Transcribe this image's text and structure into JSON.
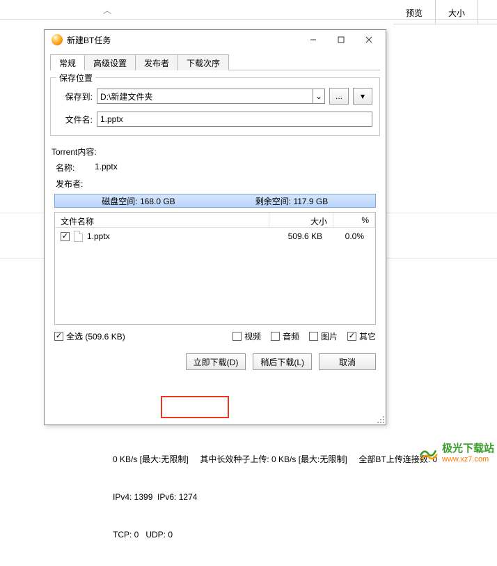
{
  "bg": {
    "col_preview": "预览",
    "col_size": "大小",
    "status_line1_a": "0 KB/s [最大:无限制]",
    "status_line1_b": "其中长效种子上传: 0 KB/s [最大:无限制]",
    "status_line1_c": "全部BT上传连接数: 0",
    "status_line2": "IPv4: 1399  IPv6: 1274",
    "status_line3": "TCP: 0   UDP: 0"
  },
  "dialog": {
    "title": "新建BT任务",
    "tabs": {
      "general": "常规",
      "advanced": "高级设置",
      "publisher": "发布者",
      "order": "下载次序"
    },
    "save_group": "保存位置",
    "save_to_label": "保存到:",
    "save_to_value": "D:\\新建文件夹",
    "browse_ellipsis": "...",
    "dropdown_caret": "▾",
    "filename_label": "文件名:",
    "filename_value": "1.pptx",
    "torrent_header": "Torrent内容:",
    "name_label": "名称:",
    "name_value": "1.pptx",
    "publisher_label": "发布者:",
    "publisher_value": "",
    "disk_total_label": "磁盘空间:",
    "disk_total_value": "168.0 GB",
    "disk_free_label": "剩余空间:",
    "disk_free_value": "117.9 GB",
    "col_filename": "文件名称",
    "col_filesize": "大小",
    "col_percent": "%",
    "files": [
      {
        "name": "1.pptx",
        "size": "509.6 KB",
        "percent": "0.0%",
        "checked": true
      }
    ],
    "select_all": "全选 (509.6 KB)",
    "filter_video": "视频",
    "filter_audio": "音频",
    "filter_image": "图片",
    "filter_other": "其它",
    "btn_download": "立即下载(D)",
    "btn_later": "稍后下载(L)",
    "btn_cancel": "取消"
  },
  "watermark": {
    "name": "极光下载站",
    "url": "www.xz7.com"
  }
}
